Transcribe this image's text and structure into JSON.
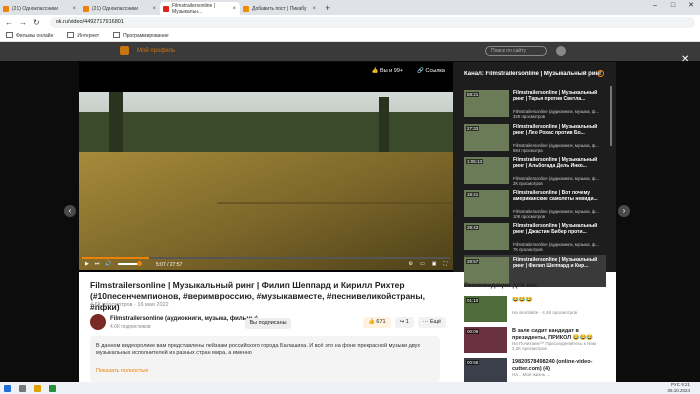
{
  "browser": {
    "tabs": [
      {
        "label": "(21) Одноклассники",
        "color": "#ee8208"
      },
      {
        "label": "(21) Одноклассники",
        "color": "#ee8208"
      },
      {
        "label": "Filmstrailersonline | Музыкальн...",
        "color": "#e62117"
      },
      {
        "label": "Добавить пост | Пикабу",
        "color": "#f08c00"
      }
    ],
    "url": "ok.ru/video/4492717916801",
    "bookmarks": [
      "Фильмы онлайн",
      "Интернет",
      "Программирование"
    ]
  },
  "okbar": {
    "menu_label": "Мой профиль",
    "search_placeholder": "Поиск по сайту"
  },
  "player": {
    "like_label": "Вы и 99+",
    "share_label": "Ссылка",
    "time": "5:07 / 27:57",
    "progress_fraction": 0.183
  },
  "channel_panel": {
    "header": "Канал: Filmstrailersonline | Музыкальный ринг",
    "items": [
      {
        "duration": "58:21",
        "title": "Filmstrailersonline | Музыкальный ринг | Тарья против Светла...",
        "meta": "Filmstrailersonline (аудиокниги, музыка, ф...",
        "views": "32К просмотров"
      },
      {
        "duration": "27:33",
        "title": "Filmstrailersonline | Музыкальный ринг | Лео Рохас против Бо...",
        "meta": "Filmstrailersonline (аудиокниги, музыка, ф...",
        "views": "594 просмотра"
      },
      {
        "duration": "1:05:13",
        "title": "Filmstrailersonline | Музыкальный ринг | Альбогада Дель Инко...",
        "meta": "Filmstrailersonline (аудиокниги, музыка, ф...",
        "views": "2К просмотров"
      },
      {
        "duration": "18:41",
        "title": "Filmstrailersonline | Вот почему американские самолеты невиди...",
        "meta": "Filmstrailersonline (аудиокниги, музыка, ф...",
        "views": "10К просмотров"
      },
      {
        "duration": "29:43",
        "title": "Filmstrailersonline | Музыкальный ринг | Джастин Бибер проти...",
        "meta": "Filmstrailersonline (аудиокниги, музыка, ф...",
        "views": "7К просмотров"
      },
      {
        "duration": "29:57",
        "title": "Filmstrailersonline | Музыкальный ринг | Филип Шеппард и Кир...",
        "meta": "",
        "views": ""
      }
    ]
  },
  "video": {
    "title": "Filmstrailersonline | Музыкальный ринг | Филип Шеппард и Кирилл Рихтер (#10песенчемпионов, #веримвроссию, #музыкавместе, #песнивеликойстраны, #пфки)",
    "meta": "4.6К просмотров · 16 мая 2022",
    "channel_name": "Filmstrailersonline (аудиокниги, музыка, фильмы)",
    "channel_subs": "4.6К подписчиков",
    "subscribe_label": "Вы подписаны",
    "likes": "671",
    "shares": "1",
    "more_label": "Ещё",
    "description": "В данном видеоролике вам представлены пейзажи российского города Балашиха. И всё это на фоне прекрасной музыки двух музыкальных исполнителей из разных стран мира, а именно",
    "show_more": "Показать полностью"
  },
  "recommendations": {
    "header": "Рекомендации для вас",
    "items": [
      {
        "duration": "01:10",
        "title": "😂😂😂",
        "meta": "На vkontakte · 4,4К просмотров"
      },
      {
        "duration": "00:09",
        "title": "В зале сидит кандидат в президенты, ПРИКОЛ 😂😂😂",
        "meta": "На Почитаем™ Присоединяйтесь к Нам · 2,2К просмотров"
      },
      {
        "duration": "00:58",
        "title": "19820578498240 (online-video-cutter.com) (4)",
        "meta": "На ...Моя жизнь ..."
      }
    ]
  },
  "taskbar": {
    "time": "9:21",
    "date": "06.10.2024",
    "lang": "РУС"
  }
}
